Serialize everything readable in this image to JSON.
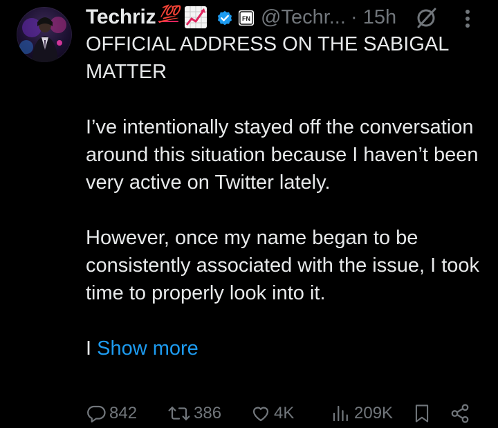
{
  "post": {
    "author_name": "Techriz",
    "emoji_100": "💯",
    "chart_emoji_icon": "chart-increasing-icon",
    "handle": "@Techr...",
    "time": "· 15h",
    "verified_color": "#1d9bf0",
    "badge_text": "FN",
    "paragraphs": [
      "OFFICIAL ADDRESS ON THE SABIGAL MATTER",
      "I’ve intentionally stayed off the conversation around this situation because I haven’t been very active on Twitter lately.",
      "However, once my name began to be consistently associated with the issue, I took time to properly look into it."
    ],
    "truncated_start": "I",
    "show_more": "Show more"
  },
  "actions": {
    "replies": "842",
    "reposts": "386",
    "likes": "4K",
    "views": "209K"
  },
  "colors": {
    "background": "#000000",
    "text": "#e7e9ea",
    "muted": "#71767b",
    "link": "#1d9bf0"
  }
}
